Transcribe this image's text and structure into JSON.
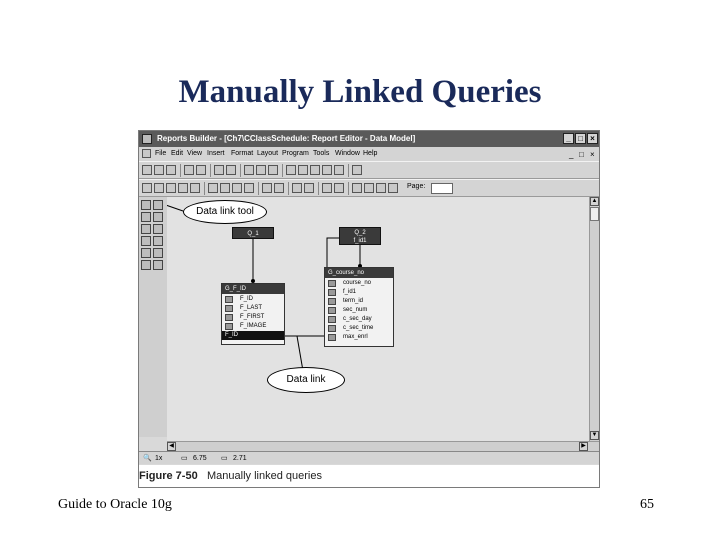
{
  "slide": {
    "title": "Manually Linked Queries",
    "footer_left": "Guide to Oracle 10g",
    "page_number": "65"
  },
  "window": {
    "title": "Reports Builder - [Ch7\\CClassSchedule: Report Editor - Data Model]",
    "buttons": {
      "minimize": "_",
      "maximize": "□",
      "close": "×"
    }
  },
  "menu": {
    "items": [
      "File",
      "Edit",
      "View",
      "Insert",
      "Format",
      "Layout",
      "Program",
      "Tools",
      "Window",
      "Help"
    ],
    "mdi_buttons": [
      "_",
      "□",
      "×"
    ]
  },
  "toolbar2": {
    "page_label": "Page:"
  },
  "status": {
    "zoom": "1x",
    "pos1": "6.75",
    "pos2": "2.71"
  },
  "queries": [
    {
      "name": "Q_1",
      "column": ""
    },
    {
      "name": "Q_2",
      "column": "f_id1"
    }
  ],
  "groups": [
    {
      "name": "G_F_ID",
      "columns": [
        "F_ID",
        "F_LAST",
        "F_FIRST",
        "F_IMAGE",
        "F_ID"
      ],
      "selected_index": 4
    },
    {
      "name": "G_course_no",
      "columns": [
        "course_no",
        "f_id1",
        "term_id",
        "sec_num",
        "c_sec_day",
        "c_sec_time",
        "max_enrl"
      ],
      "selected_index": -1
    }
  ],
  "callouts": {
    "data_link_tool": "Data link tool",
    "data_link": "Data link"
  },
  "caption": {
    "figure_number": "Figure 7-50",
    "text": "Manually linked queries"
  }
}
